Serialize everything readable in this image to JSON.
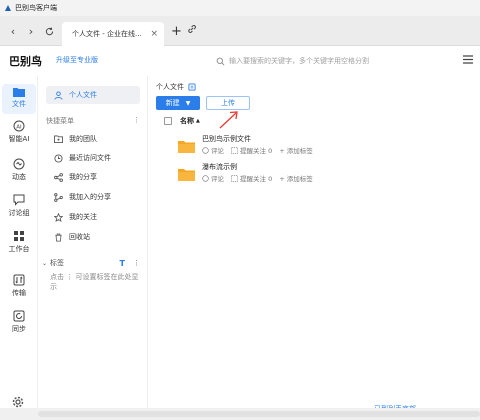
{
  "window": {
    "title": "巴别鸟客户端"
  },
  "tab": {
    "title": "个人文件 - 企业在线..."
  },
  "header": {
    "brand": "巴别鸟",
    "upgrade": "升级至专业版",
    "search_placeholder": "输入要搜索的关键字，多个关键字用空格分割"
  },
  "rail": {
    "items": [
      {
        "label": "文件",
        "icon": "folder-icon"
      },
      {
        "label": "智能AI",
        "icon": "ai-icon"
      },
      {
        "label": "动态",
        "icon": "activity-icon"
      },
      {
        "label": "讨论组",
        "icon": "chat-icon"
      },
      {
        "label": "工作台",
        "icon": "grid-icon"
      },
      {
        "label": "传输",
        "icon": "transfer-icon"
      },
      {
        "label": "同步",
        "icon": "sync-icon"
      }
    ]
  },
  "sidebar": {
    "personal": "个人文件",
    "section_title": "快捷菜单",
    "items": [
      {
        "label": "我的团队"
      },
      {
        "label": "最近访问文件"
      },
      {
        "label": "我的分享"
      },
      {
        "label": "我加入的分享"
      },
      {
        "label": "我的关注"
      },
      {
        "label": "回收站"
      }
    ],
    "tags_title": "标签",
    "tags_desc": "点击 ⋮ 可设置标签在此处显示"
  },
  "main": {
    "breadcrumb": "个人文件",
    "new_button": "新建",
    "upload_button": "上传",
    "column_name": "名称",
    "rows": [
      {
        "name": "巴别鸟示例文件",
        "comment": "评论",
        "remind": "提醒关注 0",
        "tag": "+ 添加标签"
      },
      {
        "name": "瀑布流示例",
        "comment": "评论",
        "remind": "提醒关注 0",
        "tag": "+ 添加标签"
      }
    ],
    "bottom_link": "已到列表底部"
  },
  "colors": {
    "accent": "#2b7de9",
    "folder": "#f5a623"
  }
}
